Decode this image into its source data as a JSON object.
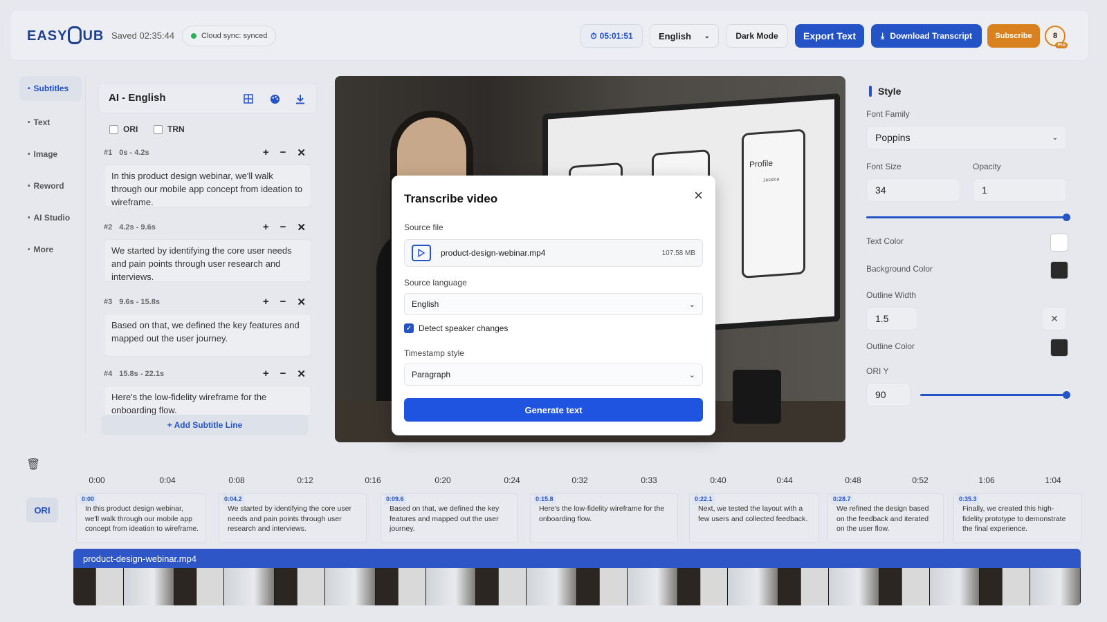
{
  "header": {
    "logo_text_left": "EASY",
    "logo_text_right": "UB",
    "saved": "Saved 02:35:44",
    "sync": "Cloud sync: synced",
    "timer": "05:01:51",
    "language": "English",
    "dark_mode": "Dark Mode",
    "export_text": "Export Text",
    "download_transcript": "Download Transcript",
    "subscribe": "Subscribe",
    "avatar_initial": "8",
    "avatar_badge": "Pro"
  },
  "nav": {
    "items": [
      "Subtitles",
      "Text",
      "Image",
      "Reword",
      "AI Studio",
      "More"
    ]
  },
  "subtitles": {
    "title": "AI - English",
    "ori_label": "ORI",
    "trn_label": "TRN",
    "segments": [
      {
        "num": "#1",
        "range": "0s - 4.2s",
        "text": "In this product design webinar, we'll walk through our mobile app concept from ideation to wireframe."
      },
      {
        "num": "#2",
        "range": "4.2s - 9.6s",
        "text": "We started by identifying the core user needs and pain points through user research and interviews."
      },
      {
        "num": "#3",
        "range": "9.6s - 15.8s",
        "text": "Based on that, we defined the key features and mapped out the user journey."
      },
      {
        "num": "#4",
        "range": "15.8s - 22.1s",
        "text": "Here's the low-fidelity wireframe for the onboarding flow."
      }
    ],
    "add_line": "+ Add Subtitle Line"
  },
  "video": {
    "profile_label": "Profile",
    "user_name": "Jessica"
  },
  "modal": {
    "title": "Transcribe video",
    "source_file_label": "Source file",
    "file_name": "product-design-webinar.mp4",
    "file_size": "107.58 MB",
    "source_language_label": "Source language",
    "source_language": "English",
    "detect_speaker": "Detect speaker changes",
    "timestamp_label": "Timestamp style",
    "timestamp_style": "Paragraph",
    "generate": "Generate text"
  },
  "style": {
    "title": "Style",
    "font_family_label": "Font Family",
    "font_family": "Poppins",
    "font_size_label": "Font Size",
    "font_size": "34",
    "opacity_label": "Opacity",
    "opacity": "1",
    "text_color_label": "Text Color",
    "text_color": "#ffffff",
    "background_color_label": "Background Color",
    "background_color": "#2a2a2a",
    "outline_width_label": "Outline Width",
    "outline_width": "1.5",
    "outline_color_label": "Outline Color",
    "outline_color": "#2a2a2a",
    "ori_y_label": "ORI Y",
    "ori_y": "90",
    "font_size_slider": 1.0,
    "ori_y_slider": 1.0
  },
  "timeline": {
    "ticks": [
      "0:00",
      "0:04",
      "0:08",
      "0:12",
      "0:16",
      "0:20",
      "0:24",
      "0:32",
      "0:33",
      "0:40",
      "0:44",
      "0:48",
      "0:52",
      "1:06",
      "1:04"
    ],
    "track_label": "ORI",
    "blocks": [
      {
        "ts": "0:00",
        "text": "In this product design webinar, we'll walk through our mobile app concept from ideation to wireframe."
      },
      {
        "ts": "0:04.2",
        "text": "We started by identifying the core user needs and pain points through user research and interviews."
      },
      {
        "ts": "0:09.6",
        "text": "Based on that, we defined the key features and mapped out the user journey."
      },
      {
        "ts": "0:15.8",
        "text": "Here's the low-fidelity wireframe for the onboarding flow."
      },
      {
        "ts": "0:22.1",
        "text": "Next, we tested the layout with a few users and collected feedback."
      },
      {
        "ts": "0:28.7",
        "text": "We refined the design based on the feedback and iterated on the user flow."
      },
      {
        "ts": "0:35.3",
        "text": "Finally, we created this high-fidelity prototype to demonstrate the final experience."
      }
    ],
    "video_track": "product-design-webinar.mp4"
  },
  "colors": {
    "accent": "#2453c6",
    "subscribe": "#d9801f",
    "sync_dot": "#2fae5b"
  }
}
